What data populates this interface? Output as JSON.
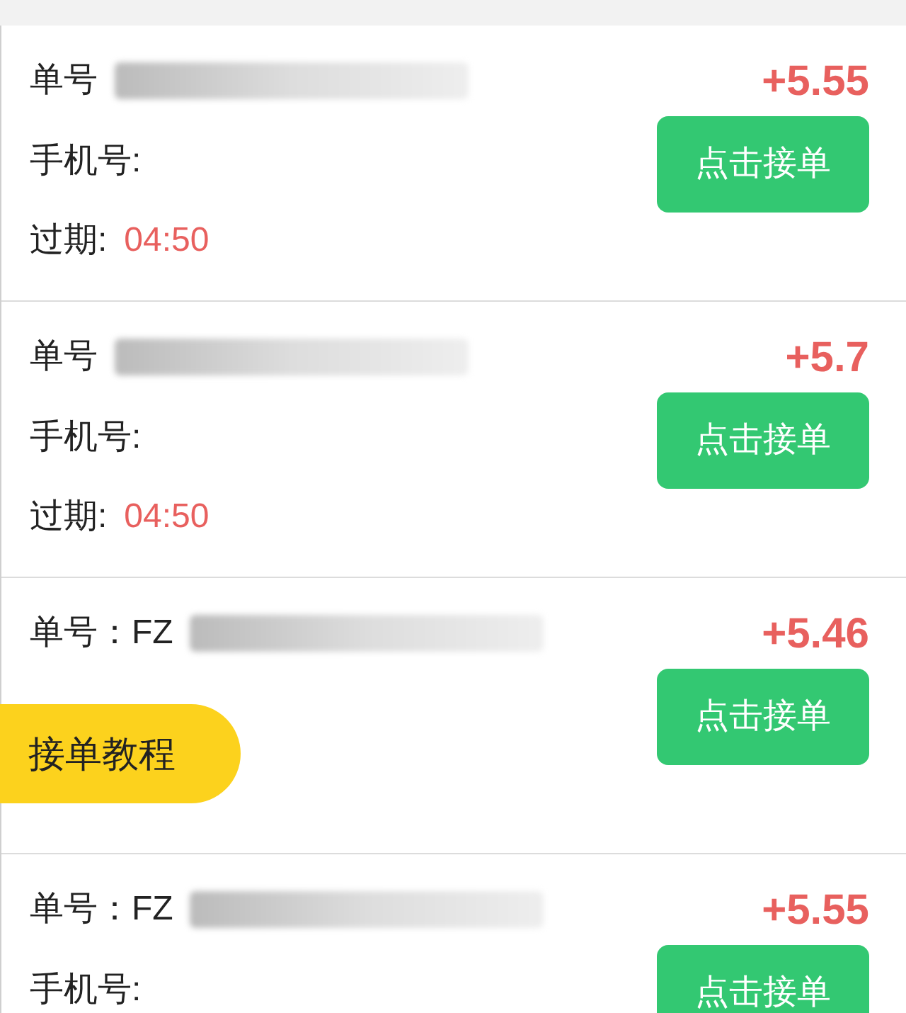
{
  "orders": [
    {
      "order_label": "单号",
      "amount": "+5.55",
      "phone_label": "手机号:",
      "expiry_label": "过期:",
      "expiry": "04:50",
      "button": "点击接单"
    },
    {
      "order_label": "单号",
      "amount": "+5.7",
      "phone_label": "手机号:",
      "expiry_label": "过期:",
      "expiry": "04:50",
      "button": "点击接单"
    },
    {
      "order_label": "单号：FZ",
      "amount": "+5.46",
      "button": "点击接单"
    },
    {
      "order_label": "单号：FZ",
      "amount": "+5.55",
      "phone_label": "手机号:",
      "button": "点击接单"
    }
  ],
  "floating_button": "接单教程"
}
